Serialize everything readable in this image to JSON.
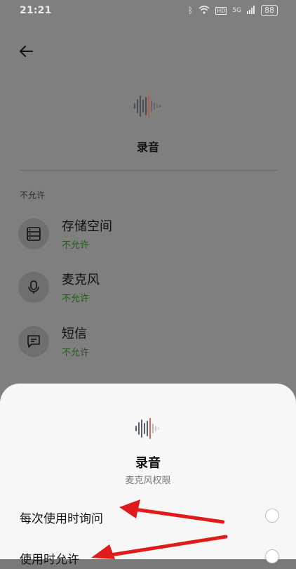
{
  "status_bar": {
    "time": "21:21",
    "battery": "88",
    "network": "5G"
  },
  "app": {
    "name": "录音"
  },
  "section": {
    "label": "不允许"
  },
  "permissions": [
    {
      "name": "存储空间",
      "status": "不允许",
      "icon": "storage-icon"
    },
    {
      "name": "麦克风",
      "status": "不允许",
      "icon": "microphone-icon"
    },
    {
      "name": "短信",
      "status": "不允许",
      "icon": "sms-icon"
    }
  ],
  "sheet": {
    "title": "录音",
    "subtitle": "麦克风权限",
    "options": [
      {
        "label": "每次使用时询问"
      },
      {
        "label": "使用时允许"
      }
    ]
  },
  "colors": {
    "allowed_status": "#2f8f2f",
    "annotation_arrow": "#e01b1b"
  }
}
